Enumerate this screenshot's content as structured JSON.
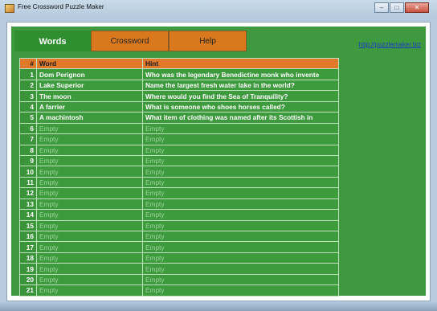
{
  "window": {
    "title": "Free Crossword Puzzle Maker"
  },
  "tabs": [
    {
      "label": "Words"
    },
    {
      "label": "Crossword"
    },
    {
      "label": "Help"
    }
  ],
  "link": "http://puzzlemaker.biz",
  "table": {
    "headers": {
      "num": "#",
      "word": "Word",
      "hint": "Hint"
    },
    "rows": [
      {
        "num": "1",
        "word": "Dom Perignon",
        "hint": "Who was the legendary Benedictine monk who invente"
      },
      {
        "num": "2",
        "word": "Lake Superior",
        "hint": "Name the largest fresh water lake in the world?"
      },
      {
        "num": "3",
        "word": "The moon",
        "hint": "Where would you find the Sea of Tranquility?"
      },
      {
        "num": "4",
        "word": "A farrier",
        "hint": "What is someone who shoes horses called?"
      },
      {
        "num": "5",
        "word": "A machintosh",
        "hint": "What item of clothing was named after its Scottish in"
      },
      {
        "num": "6",
        "word": "Empty",
        "hint": "Empty"
      },
      {
        "num": "7",
        "word": "Empty",
        "hint": "Empty"
      },
      {
        "num": "8",
        "word": "Empty",
        "hint": "Empty"
      },
      {
        "num": "9",
        "word": "Empty",
        "hint": "Empty"
      },
      {
        "num": "10",
        "word": "Empty",
        "hint": "Empty"
      },
      {
        "num": "11",
        "word": "Empty",
        "hint": "Empty"
      },
      {
        "num": "12",
        "word": "Empty",
        "hint": "Empty"
      },
      {
        "num": "13",
        "word": "Empty",
        "hint": "Empty"
      },
      {
        "num": "14",
        "word": "Empty",
        "hint": "Empty"
      },
      {
        "num": "15",
        "word": "Empty",
        "hint": "Empty"
      },
      {
        "num": "16",
        "word": "Empty",
        "hint": "Empty"
      },
      {
        "num": "17",
        "word": "Empty",
        "hint": "Empty"
      },
      {
        "num": "18",
        "word": "Empty",
        "hint": "Empty"
      },
      {
        "num": "19",
        "word": "Empty",
        "hint": "Empty"
      },
      {
        "num": "20",
        "word": "Empty",
        "hint": "Empty"
      },
      {
        "num": "21",
        "word": "Empty",
        "hint": "Empty"
      }
    ]
  },
  "icons": {
    "app": "crossword-app-icon",
    "minimize": "minimize-icon",
    "maximize": "maximize-icon",
    "close": "close-icon"
  },
  "colors": {
    "panel_green": "#3f9a3f",
    "active_tab": "#2f8f2f",
    "inactive_tab": "#d9781c",
    "header_orange": "#e07a2a",
    "empty_text": "#9ed39e"
  }
}
